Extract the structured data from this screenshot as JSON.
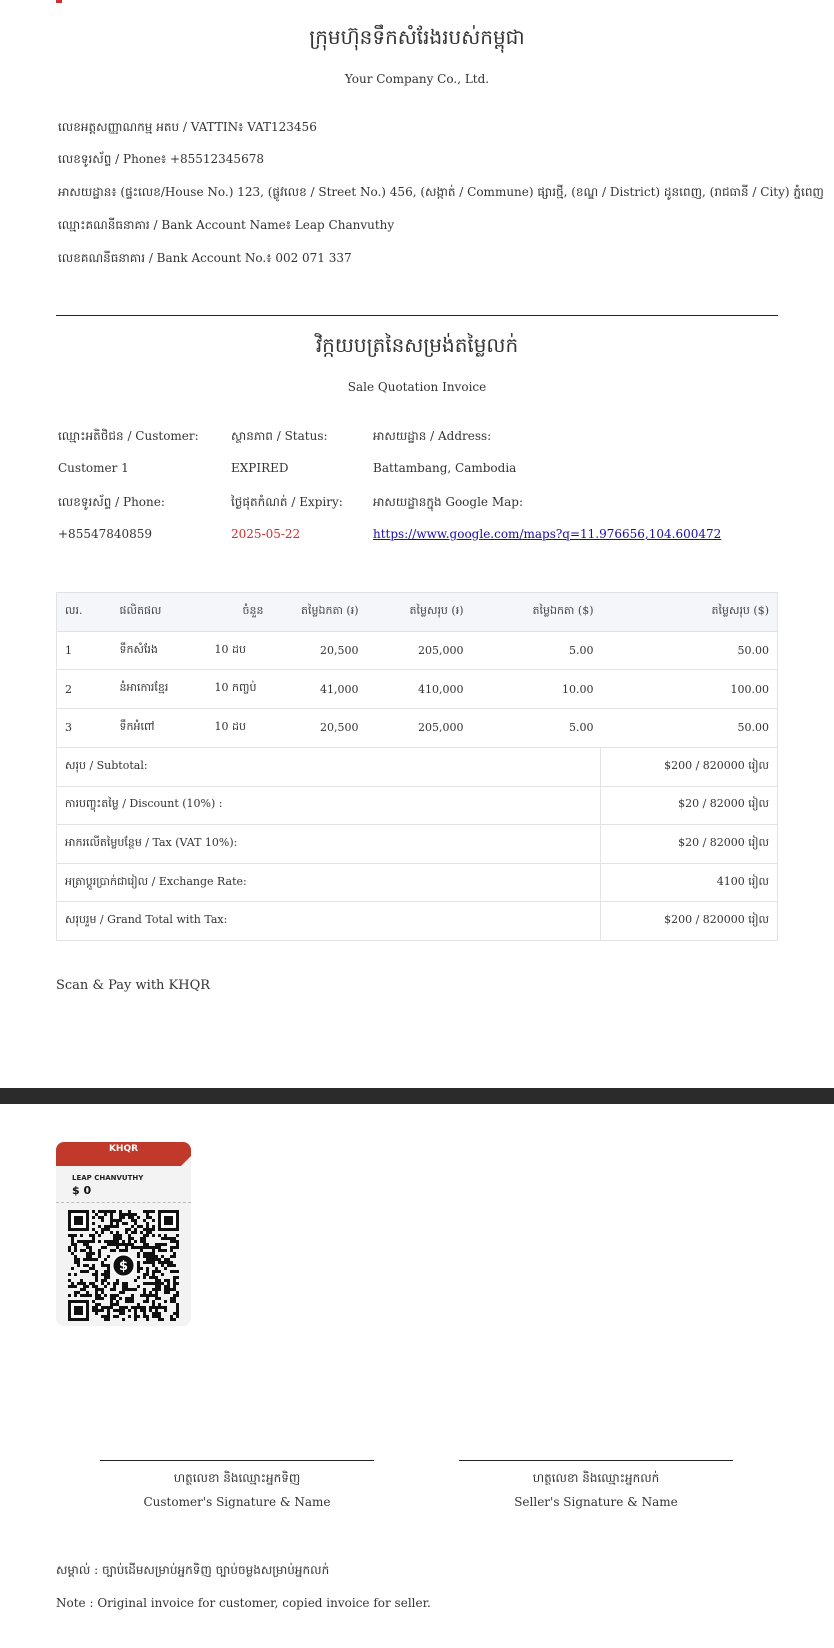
{
  "company": {
    "name_kh": "ក្រុមហ៊ុនទឹកសំរែងរបស់កម្ពុជា",
    "name_en": "Your Company Co., Ltd.",
    "vattin": "លេខអត្តសញ្ញាណកម្ម អតប / VATTIN៖ VAT123456",
    "phone": "លេខទូរស័ព្ទ / Phone៖ +85512345678",
    "address": "អាសយដ្ឋាន៖ (ផ្ទះលេខ/House No.) 123, (ផ្លូវលេខ / Street No.) 456, (សង្កាត់ / Commune) ផ្សារថ្មី, (ខណ្ឌ / District) ដូនពេញ, (រាជធានី / City) ភ្នំពេញ",
    "bank_name": "ឈ្មោះគណនីធនាគារ / Bank Account Name៖ Leap Chanvuthy",
    "bank_no": "លេខគណនីធនាគារ / Bank Account No.៖ 002 071 337"
  },
  "invoice": {
    "title_kh": "វិក្កយបត្រនៃសម្រង់តម្លៃលក់",
    "title_en": "Sale Quotation Invoice"
  },
  "customer": {
    "name_label": "ឈ្មោះអតិថិជន / Customer:",
    "name": "Customer 1",
    "phone_label": "លេខទូរស័ព្ទ / Phone:",
    "phone": "+85547840859",
    "status_label": "ស្ថានភាព / Status:",
    "status": "EXPIRED",
    "expiry_label": "ថ្ងៃផុតកំណត់ / Expiry:",
    "expiry": "2025-05-22",
    "address_label": "អាសយដ្ឋាន / Address:",
    "address": "Battambang, Cambodia",
    "map_label": "អាសយដ្ឋានក្នុង Google Map:",
    "map_url": "https://www.google.com/maps?q=11.976656,104.600472"
  },
  "table": {
    "headers": [
      "លរ.",
      "ផលិតផល",
      "ចំនួន",
      "តម្លៃឯកតា (៛)",
      "តម្លៃសរុប (៛)",
      "តម្លៃឯកតា ($)",
      "តម្លៃសរុប ($)"
    ],
    "rows": [
      [
        "1",
        "ទឹកសំរែង",
        "10 ដប",
        "20,500",
        "205,000",
        "5.00",
        "50.00"
      ],
      [
        "2",
        "នំអាកោរខ្មែរ",
        "10 កញ្ចប់",
        "41,000",
        "410,000",
        "10.00",
        "100.00"
      ],
      [
        "3",
        "ទឹកអំពៅ",
        "10 ដប",
        "20,500",
        "205,000",
        "5.00",
        "50.00"
      ]
    ]
  },
  "totals": [
    {
      "label": "សរុប / Subtotal:",
      "value": "$200 / 820000 រៀល"
    },
    {
      "label": "ការបញ្ចុះតម្លៃ / Discount (10%) :",
      "value": "$20 / 82000 រៀល"
    },
    {
      "label": "អាករលើតម្លៃបន្ថែម / Tax (VAT 10%):",
      "value": "$20 / 82000 រៀល"
    },
    {
      "label": "អត្រាប្តូរប្រាក់ជារៀល / Exchange Rate:",
      "value": "4100 រៀល"
    },
    {
      "label": "សរុបរួម / Grand Total with Tax:",
      "value": "$200 / 820000 រៀល"
    }
  ],
  "scan_label": "Scan & Pay with KHQR",
  "khqr": {
    "brand": "KHQR",
    "name": "LEAP CHANVUTHY",
    "amount": "$ 0",
    "center_icon": "dollar-icon"
  },
  "signatures": {
    "customer_kh": "ហត្ថលេខា និងឈ្មោះអ្នកទិញ",
    "customer_en": "Customer's Signature & Name",
    "seller_kh": "ហត្ថលេខា និងឈ្មោះអ្នកលក់",
    "seller_en": "Seller's Signature & Name"
  },
  "note": {
    "kh": "សម្គាល់ : ច្បាប់ដើមសម្រាប់អ្នកទិញ ច្បាប់ចម្លងសម្រាប់អ្នកលក់",
    "en": "Note : Original invoice for customer, copied invoice for seller."
  },
  "colors": {
    "accent_red": "#d32f2f",
    "khqr_red": "#c0392b",
    "link": "#1a0dab"
  }
}
